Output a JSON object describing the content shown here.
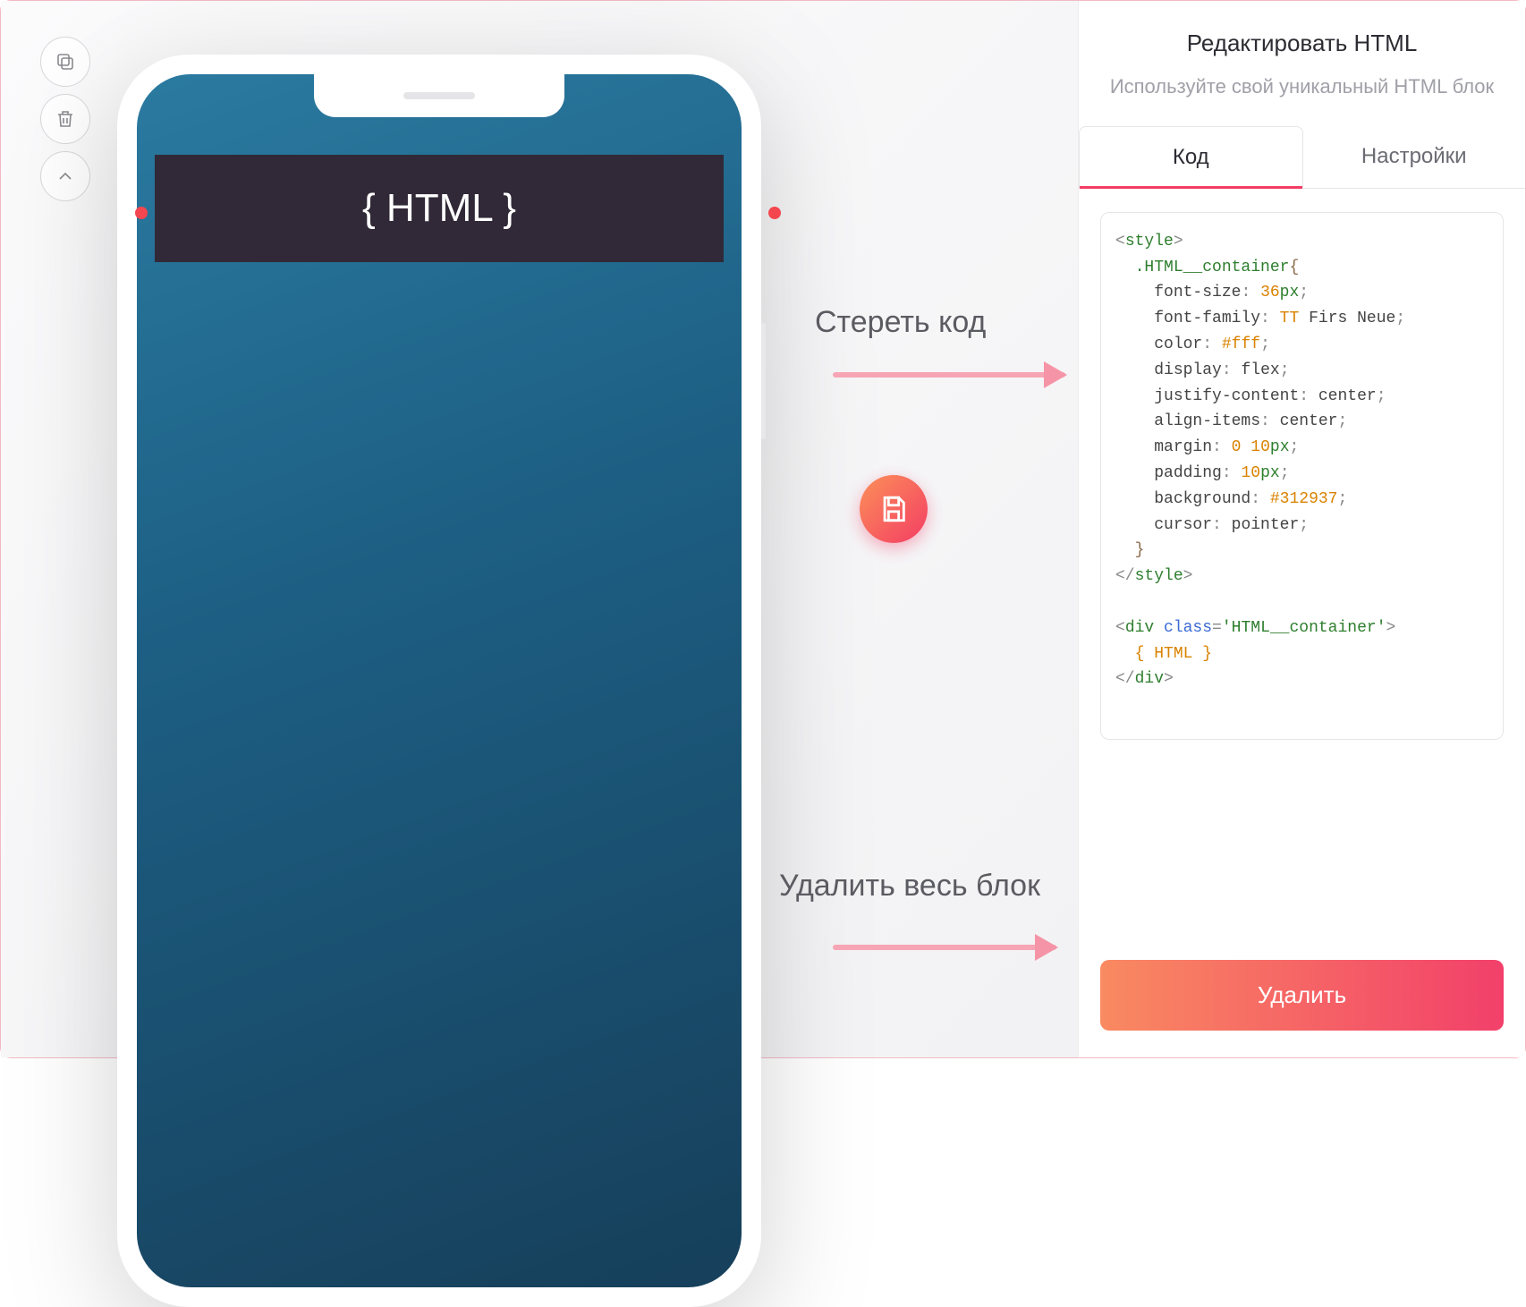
{
  "toolbar": {
    "copy": "copy",
    "delete": "delete",
    "collapse": "collapse"
  },
  "phone": {
    "html_block_label": "{ HTML }"
  },
  "annotations": {
    "erase_code": "Стереть код",
    "delete_block": "Удалить весь блок"
  },
  "panel": {
    "title": "Редактировать HTML",
    "subtitle": "Используйте свой уникальный HTML блок",
    "tabs": {
      "code": "Код",
      "settings": "Настройки"
    },
    "code": {
      "style_open": "style",
      "selector": ".HTML__container",
      "props": {
        "font_size": "font-size",
        "font_size_val": "36",
        "font_size_unit": "px",
        "font_family": "font-family",
        "font_family_val1": "TT",
        "font_family_val2": "Firs Neue",
        "color": "color",
        "color_val": "#fff",
        "display": "display",
        "display_val": "flex",
        "justify_content": "justify-content",
        "justify_content_val": "center",
        "align_items": "align-items",
        "align_items_val": "center",
        "margin": "margin",
        "margin_val1": "0",
        "margin_val2": "10",
        "margin_unit": "px",
        "padding": "padding",
        "padding_val": "10",
        "padding_unit": "px",
        "background": "background",
        "background_val": "#312937",
        "cursor": "cursor",
        "cursor_val": "pointer"
      },
      "style_close": "style",
      "div_tag": "div",
      "class_attr": "class",
      "class_val": "'HTML__container'",
      "div_text": "{ HTML }",
      "div_close": "div"
    },
    "delete_button": "Удалить"
  }
}
